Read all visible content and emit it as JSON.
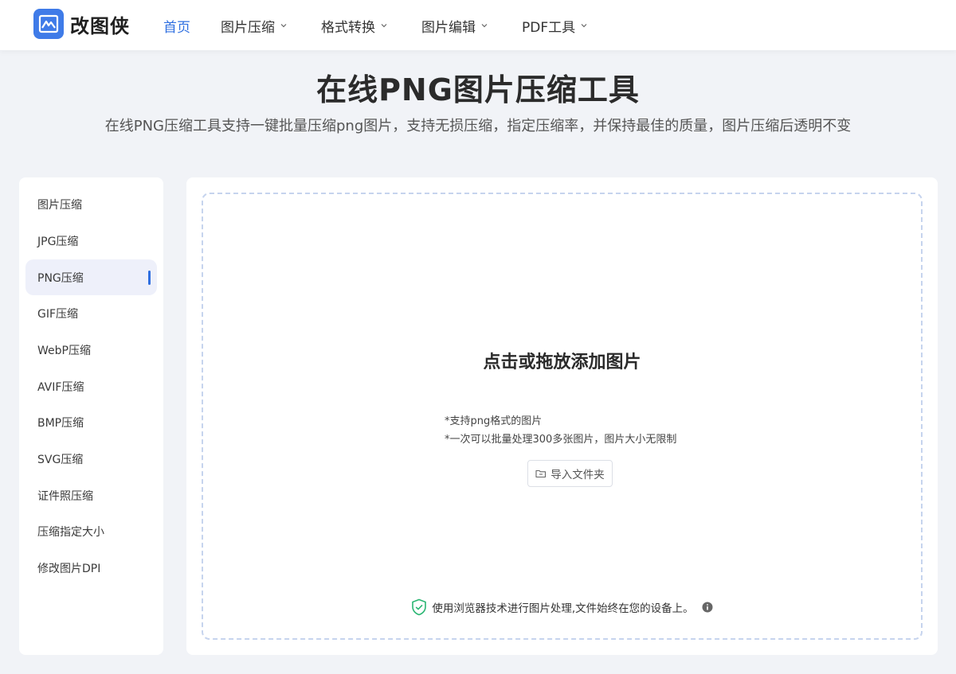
{
  "brand": {
    "name": "改图侠",
    "accent": "#2f6fe0",
    "logo_bg": "#3f7be8"
  },
  "nav": {
    "items": [
      {
        "label": "首页",
        "active": true,
        "has_dropdown": false
      },
      {
        "label": "图片压缩",
        "active": false,
        "has_dropdown": true
      },
      {
        "label": "格式转换",
        "active": false,
        "has_dropdown": true
      },
      {
        "label": "图片编辑",
        "active": false,
        "has_dropdown": true
      },
      {
        "label": "PDF工具",
        "active": false,
        "has_dropdown": true
      }
    ]
  },
  "hero": {
    "title": "在线PNG图片压缩工具",
    "subtitle": "在线PNG压缩工具支持一键批量压缩png图片，支持无损压缩，指定压缩率，并保持最佳的质量，图片压缩后透明不变"
  },
  "sidebar": {
    "items": [
      {
        "label": "图片压缩",
        "active": false
      },
      {
        "label": "JPG压缩",
        "active": false
      },
      {
        "label": "PNG压缩",
        "active": true
      },
      {
        "label": "GIF压缩",
        "active": false
      },
      {
        "label": "WebP压缩",
        "active": false
      },
      {
        "label": "AVIF压缩",
        "active": false
      },
      {
        "label": "BMP压缩",
        "active": false
      },
      {
        "label": "SVG压缩",
        "active": false
      },
      {
        "label": "证件照压缩",
        "active": false
      },
      {
        "label": "压缩指定大小",
        "active": false
      },
      {
        "label": "修改图片DPI",
        "active": false
      }
    ]
  },
  "upload": {
    "title": "点击或拖放添加图片",
    "notes": [
      "*支持png格式的图片",
      "*一次可以批量处理300多张图片，图片大小无限制"
    ],
    "import_button": "导入文件夹",
    "privacy_note": "使用浏览器技术进行图片处理,文件始终在您的设备上。",
    "icons": {
      "folder": "folder-icon",
      "shield": "shield-check-icon",
      "info": "info-icon"
    }
  }
}
